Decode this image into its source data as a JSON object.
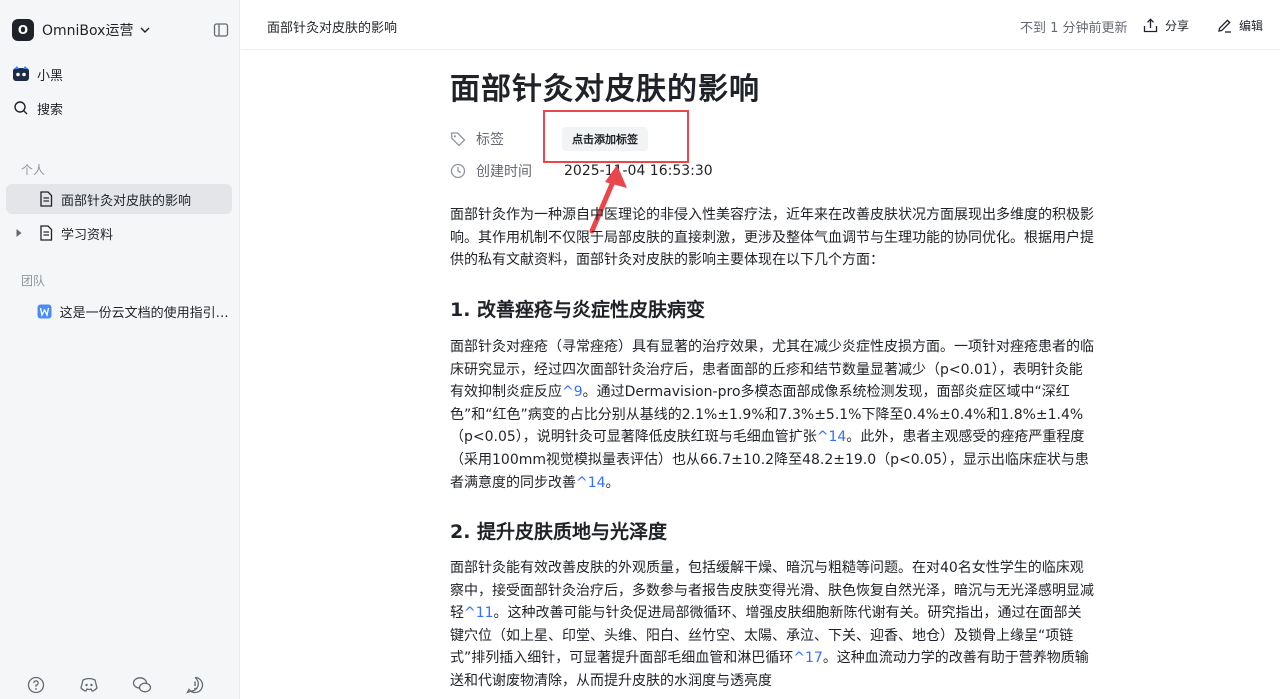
{
  "workspace": {
    "logo_letter": "O",
    "name": "OmniBox运营"
  },
  "sidebar": {
    "user": "小黑",
    "search": "搜索",
    "section_personal": "个人",
    "personal_items": [
      "面部针灸对皮肤的影响",
      "学习资料"
    ],
    "section_team": "团队",
    "team_items": [
      "这是一份云文档的使用指引.d..."
    ]
  },
  "topbar": {
    "breadcrumb": "面部针灸对皮肤的影响",
    "updated": "不到 1 分钟前更新",
    "share": "分享",
    "edit": "编辑"
  },
  "document": {
    "title": "面部针灸对皮肤的影响",
    "tag_label": "标签",
    "tag_button": "点击添加标签",
    "created_label": "创建时间",
    "created_value": "2025-11-04 16:53:30",
    "intro": "面部针灸作为一种源自中医理论的非侵入性美容疗法，近年来在改善皮肤状况方面展现出多维度的积极影响。其作用机制不仅限于局部皮肤的直接刺激，更涉及整体气血调节与生理功能的协同优化。根据用户提供的私有文献资料，面部针灸对皮肤的影响主要体现在以下几个方面：",
    "h1": "1. 改善痤疮与炎症性皮肤病变",
    "s1_a": "面部针灸对痤疮（寻常痤疮）具有显著的治疗效果，尤其在减少炎症性皮损方面。一项针对痤疮患者的临床研究显示，经过四次面部针灸治疗后，患者面部的丘疹和结节数量显著减少（p<0.01），表明针灸能有效抑制炎症反应",
    "s1_ref1": "^9",
    "s1_b": "。通过Dermavision-pro多模态面部成像系统检测发现，面部炎症区域中“深红色”和“红色”病变的占比分别从基线的2.1%±1.9%和7.3%±5.1%下降至0.4%±0.4%和1.8%±1.4%（p<0.05），说明针灸可显著降低皮肤红斑与毛细血管扩张",
    "s1_ref2": "^14",
    "s1_c": "。此外，患者主观感受的痤疮严重程度（采用100mm视觉模拟量表评估）也从66.7±10.2降至48.2±19.0（p<0.05），显示出临床症状与患者满意度的同步改善",
    "s1_ref3": "^14",
    "s1_d": "。",
    "h2": "2. 提升皮肤质地与光泽度",
    "s2_a": "面部针灸能有效改善皮肤的外观质量，包括缓解干燥、暗沉与粗糙等问题。在对40名女性学生的临床观察中，接受面部针灸治疗后，多数参与者报告皮肤变得光滑、肤色恢复自然光泽，暗沉与无光泽感明显减轻",
    "s2_ref1": "^11",
    "s2_b": "。这种改善可能与针灸促进局部微循环、增强皮肤细胞新陈代谢有关。研究指出，通过在面部关键穴位（如上星、印堂、头维、阳白、丝竹空、太陽、承泣、下关、迎香、地仓）及锁骨上缘呈“项链式”排列插入细针，可显著提升面部毛细血管和淋巴循环",
    "s2_ref2": "^17",
    "s2_c": "。这种血流动力学的改善有助于营养物质输送和代谢废物清除，从而提升皮肤的水润度与透亮度"
  },
  "colors": {
    "accent": "#3370ff",
    "highlight": "#e8474c"
  }
}
